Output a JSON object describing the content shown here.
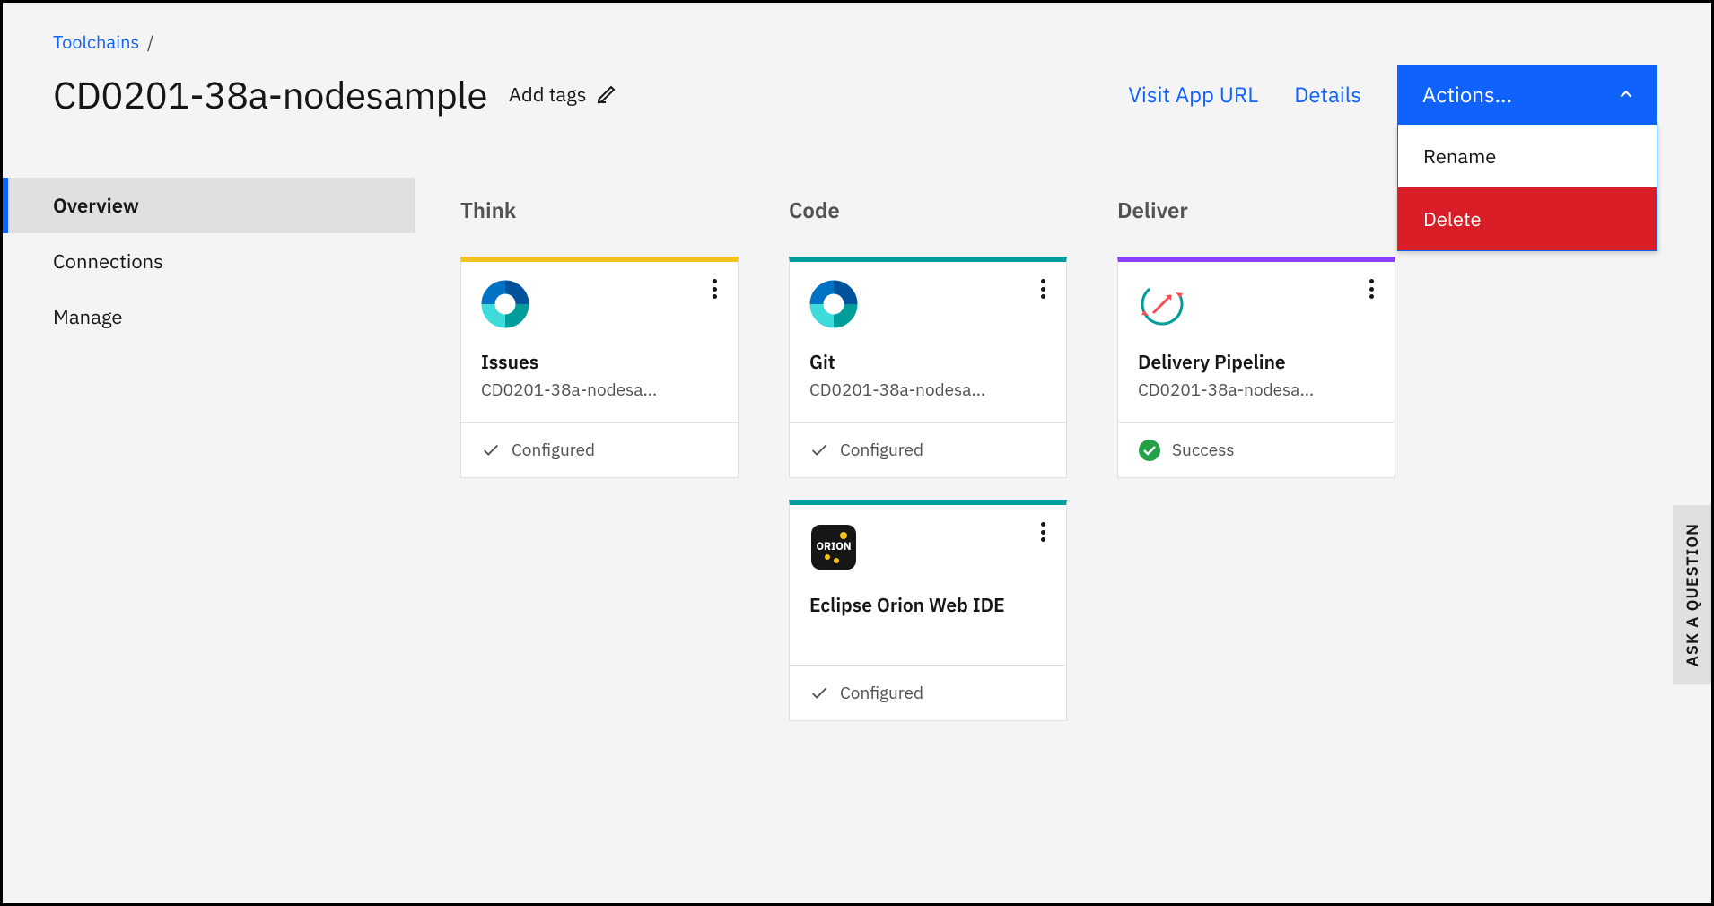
{
  "breadcrumb": {
    "root": "Toolchains"
  },
  "page": {
    "title": "CD0201-38a-nodesample",
    "add_tags": "Add tags"
  },
  "header_links": {
    "visit": "Visit App URL",
    "details": "Details"
  },
  "actions": {
    "label": "Actions...",
    "items": {
      "rename": "Rename",
      "delete": "Delete"
    }
  },
  "sidebar": {
    "items": [
      {
        "label": "Overview"
      },
      {
        "label": "Connections"
      },
      {
        "label": "Manage"
      }
    ]
  },
  "columns": {
    "think": {
      "title": "Think",
      "cards": [
        {
          "title": "Issues",
          "sub": "CD0201-38a-nodesa...",
          "status": "Configured",
          "status_type": "configured"
        }
      ]
    },
    "code": {
      "title": "Code",
      "cards": [
        {
          "title": "Git",
          "sub": "CD0201-38a-nodesa...",
          "status": "Configured",
          "status_type": "configured"
        },
        {
          "title": "Eclipse Orion Web IDE",
          "sub": "",
          "status": "Configured",
          "status_type": "configured"
        }
      ]
    },
    "deliver": {
      "title": "Deliver",
      "cards": [
        {
          "title": "Delivery Pipeline",
          "sub": "CD0201-38a-nodesa...",
          "status": "Success",
          "status_type": "success"
        }
      ]
    }
  },
  "ask_tab": "ASK A QUESTION"
}
